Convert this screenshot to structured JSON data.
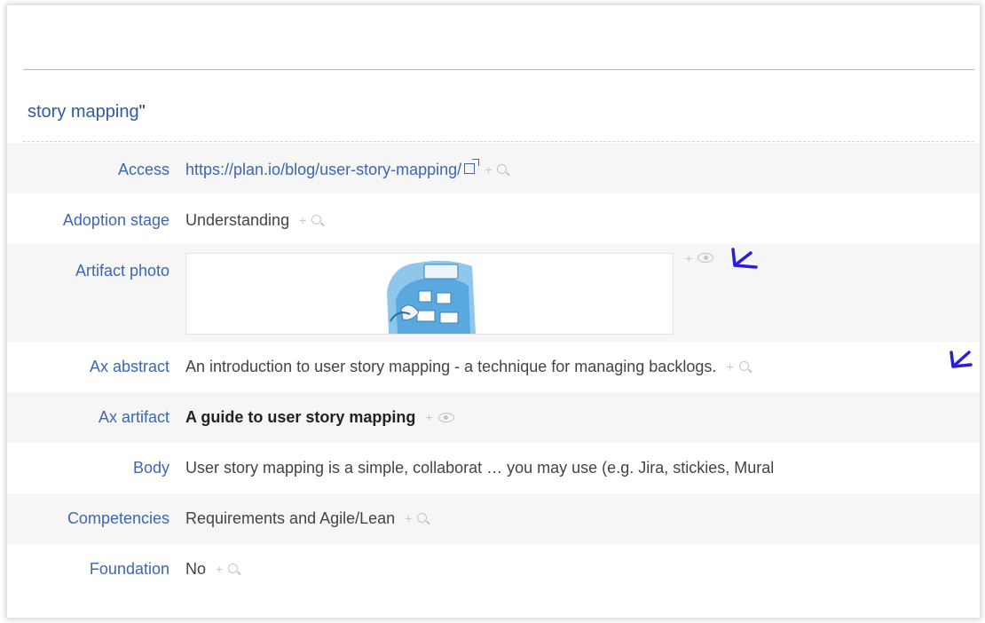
{
  "page": {
    "title": "story mapping",
    "title_suffix": "\""
  },
  "properties": [
    {
      "label": "Access",
      "value": "https://plan.io/blog/user-story-mapping/",
      "kind": "link",
      "tool_icon": "search-icon"
    },
    {
      "label": "Adoption stage",
      "value": "Understanding",
      "kind": "text",
      "tool_icon": "search-icon"
    },
    {
      "label": "Artifact photo",
      "value": "",
      "kind": "image",
      "tool_icon": "eye-icon"
    },
    {
      "label": "Ax abstract",
      "value": "An introduction to user story mapping - a technique for managing backlogs.",
      "kind": "text",
      "tool_icon": "search-icon"
    },
    {
      "label": "Ax artifact",
      "value": "A guide to user story mapping",
      "kind": "bold",
      "tool_icon": "eye-icon"
    },
    {
      "label": "Body",
      "value": "User story mapping is a simple, collaborat … you may use (e.g. Jira, stickies, Mural",
      "kind": "text",
      "tool_icon": ""
    },
    {
      "label": "Competencies",
      "value": "Requirements and Agile/Lean",
      "kind": "text",
      "tool_icon": "search-icon"
    },
    {
      "label": "Foundation",
      "value": "No",
      "kind": "text",
      "tool_icon": "search-icon"
    }
  ],
  "tools": {
    "plus": "+"
  },
  "annotations": {
    "color": "#2a1fd6"
  },
  "colors": {
    "label": "#3d66b5",
    "value": "#444444",
    "alt_row": "#f6f6f6"
  }
}
